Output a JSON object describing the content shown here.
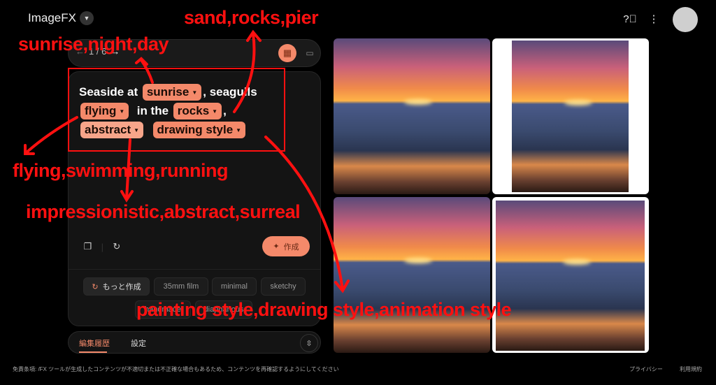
{
  "header": {
    "app_title": "ImageFX",
    "help_icon": "help-circle-icon",
    "more_icon": "more-vert-icon"
  },
  "navigator": {
    "prev": "←",
    "page": "1 / 6",
    "next": "→"
  },
  "prompt": {
    "segments": [
      "Seaside at",
      "sunrise",
      ", seagulls",
      "flying",
      "in the",
      "rocks",
      ",",
      "abstract",
      "drawing style"
    ]
  },
  "actions": {
    "create_label": "作成",
    "create_icon": "sparkle-icon"
  },
  "suggestions": {
    "more_label": "もっと作成",
    "chips": [
      "35mm film",
      "minimal",
      "sketchy",
      "handmade",
      "diaphanous"
    ]
  },
  "tabs": [
    {
      "label": "編集履歴",
      "active": true
    },
    {
      "label": "設定",
      "active": false
    }
  ],
  "footer": {
    "disclaimer": "免責条項: /FX ツールが生成したコンテンツが不適切または不正確な場合もあるため、コンテンツを再確認するようにしてください",
    "privacy": "プライバシー",
    "terms": "利用規約"
  },
  "annotations": {
    "rocks_options": "sand,rocks,pier",
    "sunrise_options": "sunrise,night,day",
    "flying_options": "flying,swimming,running",
    "abstract_options": "impressionistic,abstract,surreal",
    "style_options": "painting style,drawing style,animation style"
  },
  "colors": {
    "accent": "#f4896a",
    "annotation": "#ff1010",
    "background": "#000000"
  }
}
